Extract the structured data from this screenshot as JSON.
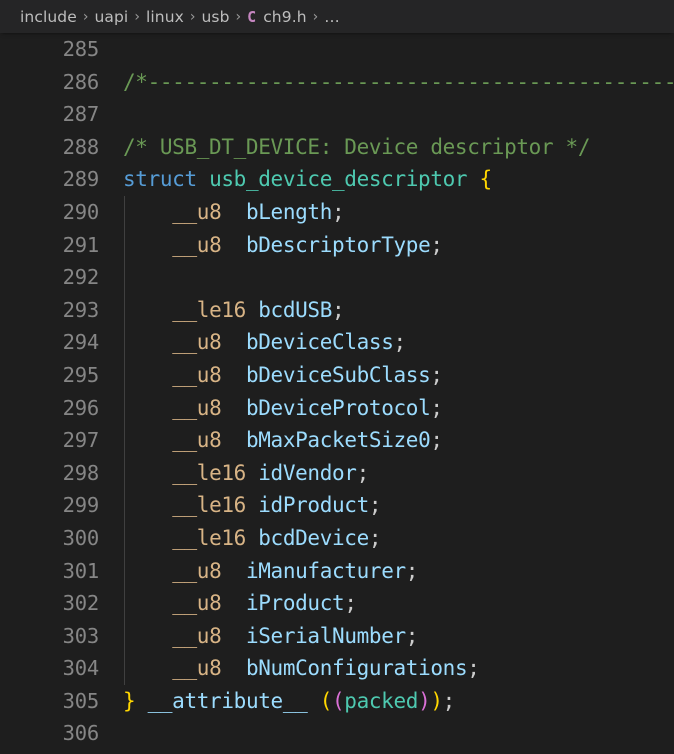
{
  "breadcrumb": {
    "separator": "›",
    "file_icon": "C",
    "ellipsis": "…",
    "items": [
      {
        "label": "include"
      },
      {
        "label": "uapi"
      },
      {
        "label": "linux"
      },
      {
        "label": "usb"
      },
      {
        "label": "ch9.h",
        "icon": "c-file-icon"
      }
    ]
  },
  "colors": {
    "editor_background": "#1e1e1e",
    "breadcrumb_background": "#252526",
    "line_number": "#868686",
    "comment": "#6a9955",
    "keyword": "#569cd6",
    "type_name": "#4ec9b0",
    "variable": "#9cdcfe",
    "macro_type": "#d8b486",
    "punctuation": "#cccccc",
    "bracket_level_1": "#ffd700",
    "bracket_level_2": "#da70d6",
    "indent_guide": "#404040",
    "file_icon": "#c586c0"
  },
  "editor": {
    "language": "c",
    "first_line_number": 285,
    "last_line_number": 306,
    "lines": [
      {
        "number": "285",
        "indent_guide": false,
        "tokens": []
      },
      {
        "number": "286",
        "indent_guide": false,
        "tokens": [
          {
            "text": "/*-------------------------------------------------------------------------*/",
            "cls": "t-comment"
          }
        ]
      },
      {
        "number": "287",
        "indent_guide": false,
        "tokens": []
      },
      {
        "number": "288",
        "indent_guide": false,
        "tokens": [
          {
            "text": "/* USB_DT_DEVICE: Device descriptor */",
            "cls": "t-comment"
          }
        ]
      },
      {
        "number": "289",
        "indent_guide": false,
        "tokens": [
          {
            "text": "struct",
            "cls": "t-keyword"
          },
          {
            "text": " ",
            "cls": "t-punct"
          },
          {
            "text": "usb_device_descriptor",
            "cls": "t-typename"
          },
          {
            "text": " ",
            "cls": "t-punct"
          },
          {
            "text": "{",
            "cls": "t-br1"
          }
        ]
      },
      {
        "number": "290",
        "indent_guide": true,
        "tokens": [
          {
            "text": "    ",
            "cls": "t-punct"
          },
          {
            "text": "__u8",
            "cls": "t-macro"
          },
          {
            "text": "  ",
            "cls": "t-punct"
          },
          {
            "text": "bLength",
            "cls": "t-var"
          },
          {
            "text": ";",
            "cls": "t-punct"
          }
        ]
      },
      {
        "number": "291",
        "indent_guide": true,
        "tokens": [
          {
            "text": "    ",
            "cls": "t-punct"
          },
          {
            "text": "__u8",
            "cls": "t-macro"
          },
          {
            "text": "  ",
            "cls": "t-punct"
          },
          {
            "text": "bDescriptorType",
            "cls": "t-var"
          },
          {
            "text": ";",
            "cls": "t-punct"
          }
        ]
      },
      {
        "number": "292",
        "indent_guide": true,
        "tokens": []
      },
      {
        "number": "293",
        "indent_guide": true,
        "tokens": [
          {
            "text": "    ",
            "cls": "t-punct"
          },
          {
            "text": "__le16",
            "cls": "t-macro"
          },
          {
            "text": " ",
            "cls": "t-punct"
          },
          {
            "text": "bcdUSB",
            "cls": "t-var"
          },
          {
            "text": ";",
            "cls": "t-punct"
          }
        ]
      },
      {
        "number": "294",
        "indent_guide": true,
        "tokens": [
          {
            "text": "    ",
            "cls": "t-punct"
          },
          {
            "text": "__u8",
            "cls": "t-macro"
          },
          {
            "text": "  ",
            "cls": "t-punct"
          },
          {
            "text": "bDeviceClass",
            "cls": "t-var"
          },
          {
            "text": ";",
            "cls": "t-punct"
          }
        ]
      },
      {
        "number": "295",
        "indent_guide": true,
        "tokens": [
          {
            "text": "    ",
            "cls": "t-punct"
          },
          {
            "text": "__u8",
            "cls": "t-macro"
          },
          {
            "text": "  ",
            "cls": "t-punct"
          },
          {
            "text": "bDeviceSubClass",
            "cls": "t-var"
          },
          {
            "text": ";",
            "cls": "t-punct"
          }
        ]
      },
      {
        "number": "296",
        "indent_guide": true,
        "tokens": [
          {
            "text": "    ",
            "cls": "t-punct"
          },
          {
            "text": "__u8",
            "cls": "t-macro"
          },
          {
            "text": "  ",
            "cls": "t-punct"
          },
          {
            "text": "bDeviceProtocol",
            "cls": "t-var"
          },
          {
            "text": ";",
            "cls": "t-punct"
          }
        ]
      },
      {
        "number": "297",
        "indent_guide": true,
        "tokens": [
          {
            "text": "    ",
            "cls": "t-punct"
          },
          {
            "text": "__u8",
            "cls": "t-macro"
          },
          {
            "text": "  ",
            "cls": "t-punct"
          },
          {
            "text": "bMaxPacketSize0",
            "cls": "t-var"
          },
          {
            "text": ";",
            "cls": "t-punct"
          }
        ]
      },
      {
        "number": "298",
        "indent_guide": true,
        "tokens": [
          {
            "text": "    ",
            "cls": "t-punct"
          },
          {
            "text": "__le16",
            "cls": "t-macro"
          },
          {
            "text": " ",
            "cls": "t-punct"
          },
          {
            "text": "idVendor",
            "cls": "t-var"
          },
          {
            "text": ";",
            "cls": "t-punct"
          }
        ]
      },
      {
        "number": "299",
        "indent_guide": true,
        "tokens": [
          {
            "text": "    ",
            "cls": "t-punct"
          },
          {
            "text": "__le16",
            "cls": "t-macro"
          },
          {
            "text": " ",
            "cls": "t-punct"
          },
          {
            "text": "idProduct",
            "cls": "t-var"
          },
          {
            "text": ";",
            "cls": "t-punct"
          }
        ]
      },
      {
        "number": "300",
        "indent_guide": true,
        "tokens": [
          {
            "text": "    ",
            "cls": "t-punct"
          },
          {
            "text": "__le16",
            "cls": "t-macro"
          },
          {
            "text": " ",
            "cls": "t-punct"
          },
          {
            "text": "bcdDevice",
            "cls": "t-var"
          },
          {
            "text": ";",
            "cls": "t-punct"
          }
        ]
      },
      {
        "number": "301",
        "indent_guide": true,
        "tokens": [
          {
            "text": "    ",
            "cls": "t-punct"
          },
          {
            "text": "__u8",
            "cls": "t-macro"
          },
          {
            "text": "  ",
            "cls": "t-punct"
          },
          {
            "text": "iManufacturer",
            "cls": "t-var"
          },
          {
            "text": ";",
            "cls": "t-punct"
          }
        ]
      },
      {
        "number": "302",
        "indent_guide": true,
        "tokens": [
          {
            "text": "    ",
            "cls": "t-punct"
          },
          {
            "text": "__u8",
            "cls": "t-macro"
          },
          {
            "text": "  ",
            "cls": "t-punct"
          },
          {
            "text": "iProduct",
            "cls": "t-var"
          },
          {
            "text": ";",
            "cls": "t-punct"
          }
        ]
      },
      {
        "number": "303",
        "indent_guide": true,
        "tokens": [
          {
            "text": "    ",
            "cls": "t-punct"
          },
          {
            "text": "__u8",
            "cls": "t-macro"
          },
          {
            "text": "  ",
            "cls": "t-punct"
          },
          {
            "text": "iSerialNumber",
            "cls": "t-var"
          },
          {
            "text": ";",
            "cls": "t-punct"
          }
        ]
      },
      {
        "number": "304",
        "indent_guide": true,
        "tokens": [
          {
            "text": "    ",
            "cls": "t-punct"
          },
          {
            "text": "__u8",
            "cls": "t-macro"
          },
          {
            "text": "  ",
            "cls": "t-punct"
          },
          {
            "text": "bNumConfigurations",
            "cls": "t-var"
          },
          {
            "text": ";",
            "cls": "t-punct"
          }
        ]
      },
      {
        "number": "305",
        "indent_guide": false,
        "tokens": [
          {
            "text": "}",
            "cls": "t-br1"
          },
          {
            "text": " ",
            "cls": "t-punct"
          },
          {
            "text": "__attribute__",
            "cls": "t-var"
          },
          {
            "text": " ",
            "cls": "t-punct"
          },
          {
            "text": "(",
            "cls": "t-br1"
          },
          {
            "text": "(",
            "cls": "t-br2"
          },
          {
            "text": "packed",
            "cls": "t-typename"
          },
          {
            "text": ")",
            "cls": "t-br2"
          },
          {
            "text": ")",
            "cls": "t-br1"
          },
          {
            "text": ";",
            "cls": "t-punct"
          }
        ]
      },
      {
        "number": "306",
        "indent_guide": false,
        "tokens": []
      }
    ]
  }
}
